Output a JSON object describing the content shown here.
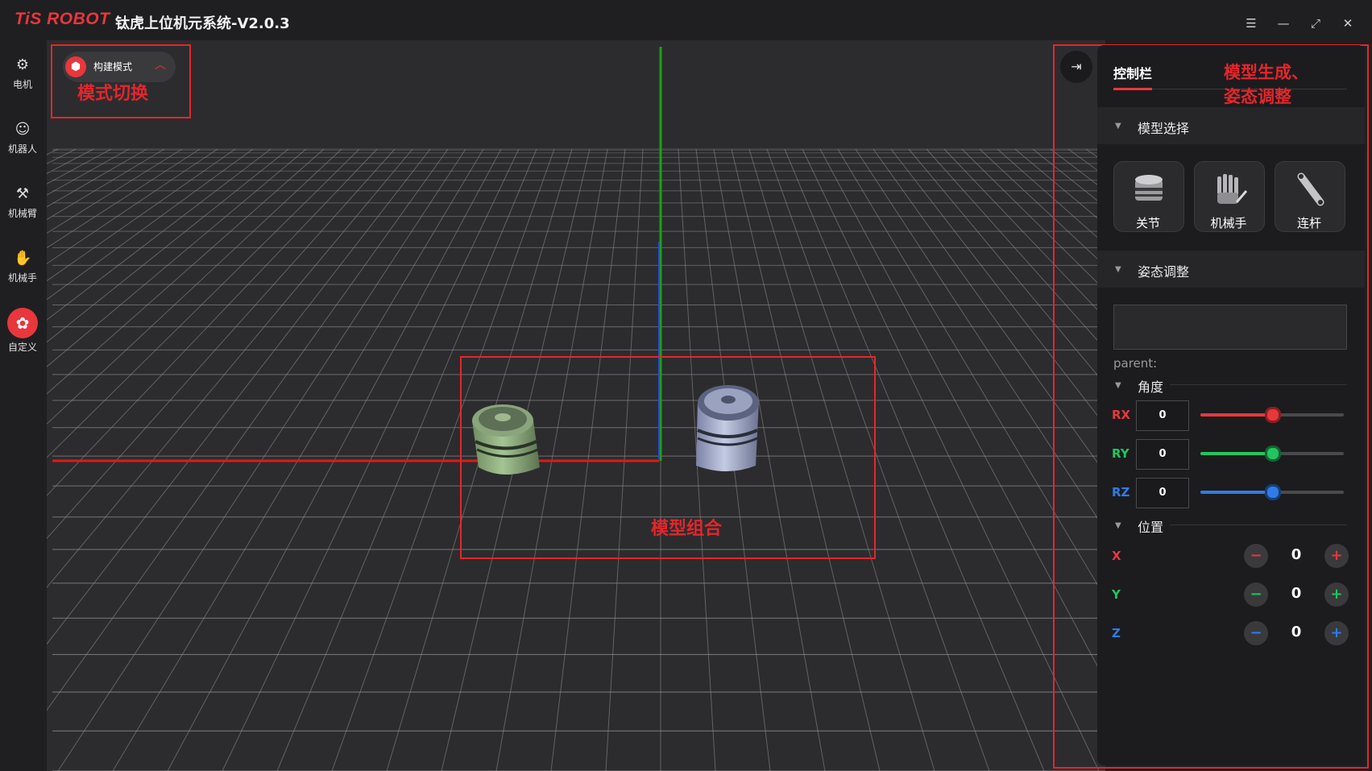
{
  "app": {
    "logo_text": "TiS ROBOT",
    "title": "钛虎上位机元系统-V2.0.3",
    "window_controls": [
      "menu-icon",
      "minimize-icon",
      "maximize-icon",
      "close-icon"
    ]
  },
  "sidebar": {
    "items": [
      {
        "label": "电机",
        "icon": "motor-icon",
        "active": false
      },
      {
        "label": "机器人",
        "icon": "robot-icon",
        "active": false
      },
      {
        "label": "机械臂",
        "icon": "robot-arm-icon",
        "active": false
      },
      {
        "label": "机械手",
        "icon": "hand-icon",
        "active": false
      },
      {
        "label": "自定义",
        "icon": "custom-icon",
        "active": true
      }
    ]
  },
  "mode": {
    "label": "构建模式",
    "annotation": "模式切换"
  },
  "viewport": {
    "annotation_combine": "模型组合"
  },
  "panel": {
    "tab": "控制栏",
    "annotation_line1": "模型生成、",
    "annotation_line2": "姿态调整",
    "model_section": "模型选择",
    "models": [
      {
        "label": "关节",
        "icon": "joint-icon"
      },
      {
        "label": "机械手",
        "icon": "hand-model-icon"
      },
      {
        "label": "连杆",
        "icon": "link-icon"
      }
    ],
    "pose_section": "姿态调整",
    "pose_input_value": "",
    "parent_label": "parent:",
    "angle_section": "角度",
    "angles": [
      {
        "axis": "RX",
        "value": "0",
        "color": "#e8373d",
        "level": 0.5
      },
      {
        "axis": "RY",
        "value": "0",
        "color": "#22c55e",
        "level": 0.5
      },
      {
        "axis": "RZ",
        "value": "0",
        "color": "#2f7be8",
        "level": 0.5
      }
    ],
    "position_section": "位置",
    "positions": [
      {
        "axis": "X",
        "value": "0",
        "color": "#e8373d"
      },
      {
        "axis": "Y",
        "value": "0",
        "color": "#22c55e"
      },
      {
        "axis": "Z",
        "value": "0",
        "color": "#2f7be8"
      }
    ]
  },
  "colors": {
    "accent": "#e8373d",
    "annotation": "#e3262c",
    "background": "#1f1f21"
  }
}
